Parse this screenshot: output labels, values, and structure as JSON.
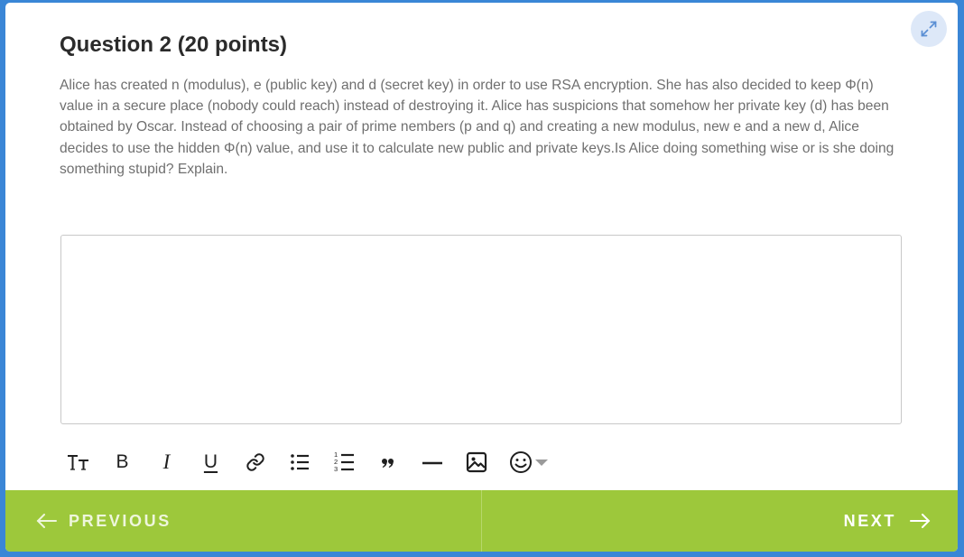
{
  "question": {
    "title": "Question 2 (20 points)",
    "text": "Alice has created n (modulus), e (public key) and d (secret key) in order to use RSA encryption. She has also decided to keep Φ(n) value in a secure place (nobody could reach) instead of destroying it. Alice has suspicions that somehow her private key (d) has been obtained by Oscar. Instead of choosing a pair of prime nembers (p and q) and creating a new modulus, new e and a new d, Alice decides to use the hidden Φ(n) value, and use it to calculate new public and private keys.Is Alice doing something wise or is she doing something stupid? Explain."
  },
  "answer": {
    "value": "",
    "placeholder": ""
  },
  "toolbar": {
    "items": [
      {
        "name": "text-size",
        "icon": "text-size-icon"
      },
      {
        "name": "bold",
        "icon": "bold-icon",
        "glyph": "B"
      },
      {
        "name": "italic",
        "icon": "italic-icon",
        "glyph": "I"
      },
      {
        "name": "underline",
        "icon": "underline-icon",
        "glyph": "U"
      },
      {
        "name": "link",
        "icon": "link-icon"
      },
      {
        "name": "bullet-list",
        "icon": "bullet-list-icon"
      },
      {
        "name": "numbered-list",
        "icon": "numbered-list-icon"
      },
      {
        "name": "quote",
        "icon": "quote-icon"
      },
      {
        "name": "horizontal-rule",
        "icon": "horizontal-rule-icon"
      },
      {
        "name": "image",
        "icon": "image-icon"
      },
      {
        "name": "emoji",
        "icon": "emoji-icon"
      }
    ]
  },
  "nav": {
    "previous_label": "PREVIOUS",
    "next_label": "NEXT"
  },
  "colors": {
    "background": "#3a86d6",
    "footer": "#9dc83b",
    "expand_button": "#dde8f8",
    "text": "#6f6f6f",
    "title": "#2b2b2b"
  }
}
